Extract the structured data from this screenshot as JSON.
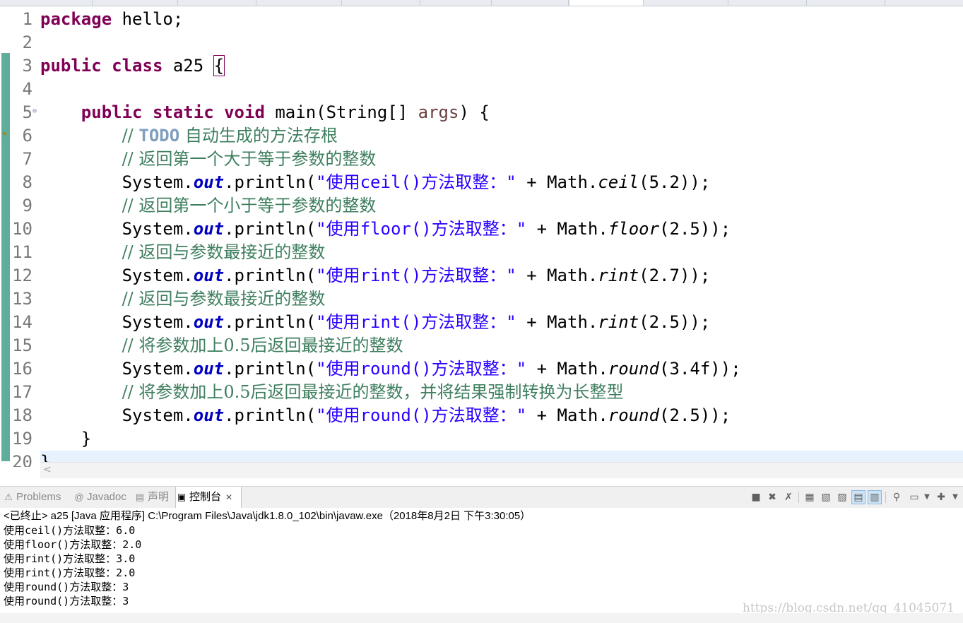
{
  "editor": {
    "lines": [
      {
        "n": "1",
        "segs": [
          {
            "t": "package",
            "c": "kw"
          },
          {
            "t": " hello;",
            "c": ""
          }
        ]
      },
      {
        "n": "2",
        "segs": []
      },
      {
        "n": "3",
        "segs": [
          {
            "t": "public",
            "c": "kw"
          },
          {
            "t": " ",
            "c": ""
          },
          {
            "t": "class",
            "c": "kw"
          },
          {
            "t": " a25 ",
            "c": ""
          },
          {
            "t": "{",
            "c": "brace-box"
          }
        ]
      },
      {
        "n": "4",
        "segs": []
      },
      {
        "n": "5",
        "segs": [
          {
            "t": "    ",
            "c": ""
          },
          {
            "t": "public",
            "c": "kw"
          },
          {
            "t": " ",
            "c": ""
          },
          {
            "t": "static",
            "c": "kw"
          },
          {
            "t": " ",
            "c": ""
          },
          {
            "t": "void",
            "c": "kw"
          },
          {
            "t": " main(String[] ",
            "c": ""
          },
          {
            "t": "args",
            "c": "arg"
          },
          {
            "t": ") {",
            "c": ""
          }
        ]
      },
      {
        "n": "6",
        "segs": [
          {
            "t": "        ",
            "c": ""
          },
          {
            "t": "// ",
            "c": "cm"
          },
          {
            "t": "TODO",
            "c": "todo"
          },
          {
            "t": " 自动生成的方法存根",
            "c": "cm"
          }
        ]
      },
      {
        "n": "7",
        "segs": [
          {
            "t": "        ",
            "c": ""
          },
          {
            "t": "// 返回第一个大于等于参数的整数",
            "c": "cm"
          }
        ]
      },
      {
        "n": "8",
        "segs": [
          {
            "t": "        System.",
            "c": ""
          },
          {
            "t": "out",
            "c": "fld"
          },
          {
            "t": ".println(",
            "c": ""
          },
          {
            "t": "\"使用ceil()方法取整：\"",
            "c": "str"
          },
          {
            "t": " + Math.",
            "c": ""
          },
          {
            "t": "ceil",
            "c": "it"
          },
          {
            "t": "(5.2));",
            "c": ""
          }
        ]
      },
      {
        "n": "9",
        "segs": [
          {
            "t": "        ",
            "c": ""
          },
          {
            "t": "// 返回第一个小于等于参数的整数",
            "c": "cm"
          }
        ]
      },
      {
        "n": "10",
        "segs": [
          {
            "t": "        System.",
            "c": ""
          },
          {
            "t": "out",
            "c": "fld"
          },
          {
            "t": ".println(",
            "c": ""
          },
          {
            "t": "\"使用floor()方法取整：\"",
            "c": "str"
          },
          {
            "t": " + Math.",
            "c": ""
          },
          {
            "t": "floor",
            "c": "it"
          },
          {
            "t": "(2.5));",
            "c": ""
          }
        ]
      },
      {
        "n": "11",
        "segs": [
          {
            "t": "        ",
            "c": ""
          },
          {
            "t": "// 返回与参数最接近的整数",
            "c": "cm"
          }
        ]
      },
      {
        "n": "12",
        "segs": [
          {
            "t": "        System.",
            "c": ""
          },
          {
            "t": "out",
            "c": "fld"
          },
          {
            "t": ".println(",
            "c": ""
          },
          {
            "t": "\"使用rint()方法取整：\"",
            "c": "str"
          },
          {
            "t": " + Math.",
            "c": ""
          },
          {
            "t": "rint",
            "c": "it"
          },
          {
            "t": "(2.7));",
            "c": ""
          }
        ]
      },
      {
        "n": "13",
        "segs": [
          {
            "t": "        ",
            "c": ""
          },
          {
            "t": "// 返回与参数最接近的整数",
            "c": "cm"
          }
        ]
      },
      {
        "n": "14",
        "segs": [
          {
            "t": "        System.",
            "c": ""
          },
          {
            "t": "out",
            "c": "fld"
          },
          {
            "t": ".println(",
            "c": ""
          },
          {
            "t": "\"使用rint()方法取整：\"",
            "c": "str"
          },
          {
            "t": " + Math.",
            "c": ""
          },
          {
            "t": "rint",
            "c": "it"
          },
          {
            "t": "(2.5));",
            "c": ""
          }
        ]
      },
      {
        "n": "15",
        "segs": [
          {
            "t": "        ",
            "c": ""
          },
          {
            "t": "// 将参数加上0.5后返回最接近的整数",
            "c": "cm"
          }
        ]
      },
      {
        "n": "16",
        "segs": [
          {
            "t": "        System.",
            "c": ""
          },
          {
            "t": "out",
            "c": "fld"
          },
          {
            "t": ".println(",
            "c": ""
          },
          {
            "t": "\"使用round()方法取整：\"",
            "c": "str"
          },
          {
            "t": " + Math.",
            "c": ""
          },
          {
            "t": "round",
            "c": "it"
          },
          {
            "t": "(3.4f));",
            "c": ""
          }
        ]
      },
      {
        "n": "17",
        "segs": [
          {
            "t": "        ",
            "c": ""
          },
          {
            "t": "// 将参数加上0.5后返回最接近的整数，并将结果强制转换为长整型",
            "c": "cm"
          }
        ]
      },
      {
        "n": "18",
        "segs": [
          {
            "t": "        System.",
            "c": ""
          },
          {
            "t": "out",
            "c": "fld"
          },
          {
            "t": ".println(",
            "c": ""
          },
          {
            "t": "\"使用round()方法取整：\"",
            "c": "str"
          },
          {
            "t": " + Math.",
            "c": ""
          },
          {
            "t": "round",
            "c": "it"
          },
          {
            "t": "(2.5));",
            "c": ""
          }
        ]
      },
      {
        "n": "19",
        "segs": [
          {
            "t": "    }",
            "c": ""
          }
        ]
      },
      {
        "n": "20",
        "segs": [
          {
            "t": "}",
            "c": ""
          }
        ]
      }
    ]
  },
  "views": {
    "tabs": [
      {
        "label": "Problems",
        "icon": "problems-icon",
        "glyph": "⚠"
      },
      {
        "label": "Javadoc",
        "icon": "javadoc-icon",
        "glyph": "@"
      },
      {
        "label": "声明",
        "icon": "declaration-icon",
        "glyph": "▤"
      },
      {
        "label": "控制台",
        "icon": "console-icon",
        "glyph": "▣"
      }
    ],
    "active_tab": "控制台"
  },
  "console": {
    "header": "<已终止> a25 [Java 应用程序] C:\\Program Files\\Java\\jdk1.8.0_102\\bin\\javaw.exe（2018年8月2日 下午3:30:05）",
    "output": [
      "使用ceil()方法取整：6.0",
      "使用floor()方法取整：2.0",
      "使用rint()方法取整：3.0",
      "使用rint()方法取整：2.0",
      "使用round()方法取整：3",
      "使用round()方法取整：3"
    ],
    "watermark": "https://blog.csdn.net/qq_41045071"
  },
  "toolbar_icons": [
    "terminate-icon",
    "remove-launch-icon",
    "remove-all-icon",
    "clear-console-icon",
    "scroll-lock-icon",
    "word-wrap-icon",
    "show-on-stdout-icon",
    "show-on-stderr-icon",
    "pin-console-icon",
    "display-console-icon",
    "open-console-icon"
  ]
}
